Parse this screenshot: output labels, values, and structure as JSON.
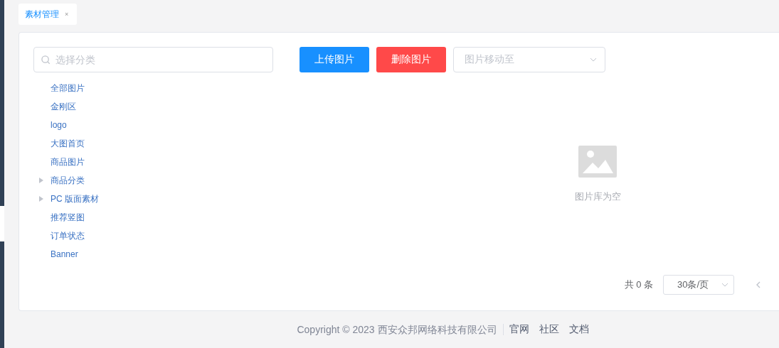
{
  "tabs": [
    {
      "label": "素材管理",
      "close": "×",
      "selected": true
    }
  ],
  "search": {
    "placeholder": "选择分类"
  },
  "tree": [
    {
      "label": "全部图片",
      "kind": "leaf"
    },
    {
      "label": "金刚区",
      "kind": "leaf"
    },
    {
      "label": "logo",
      "kind": "leaf"
    },
    {
      "label": "大图首页",
      "kind": "leaf"
    },
    {
      "label": "商品图片",
      "kind": "leaf"
    },
    {
      "label": "商品分类",
      "kind": "folder"
    },
    {
      "label": "PC 版面素材",
      "kind": "folder"
    },
    {
      "label": "推荐竖图",
      "kind": "leaf"
    },
    {
      "label": "订单状态",
      "kind": "leaf"
    },
    {
      "label": "Banner",
      "kind": "leaf"
    }
  ],
  "toolbar": [
    {
      "label": "上传图片",
      "kind": "primary"
    },
    {
      "label": "删除图片",
      "kind": "danger"
    }
  ],
  "move_select": {
    "placeholder": "图片移动至"
  },
  "empty": {
    "text": "图片库为空"
  },
  "pagination": {
    "total": "共 0 条",
    "page_size": "30条/页"
  },
  "footer": {
    "copyright": "Copyright © 2023 西安众邦网络科技有限公司",
    "links": [
      "官网",
      "社区",
      "文档"
    ]
  }
}
